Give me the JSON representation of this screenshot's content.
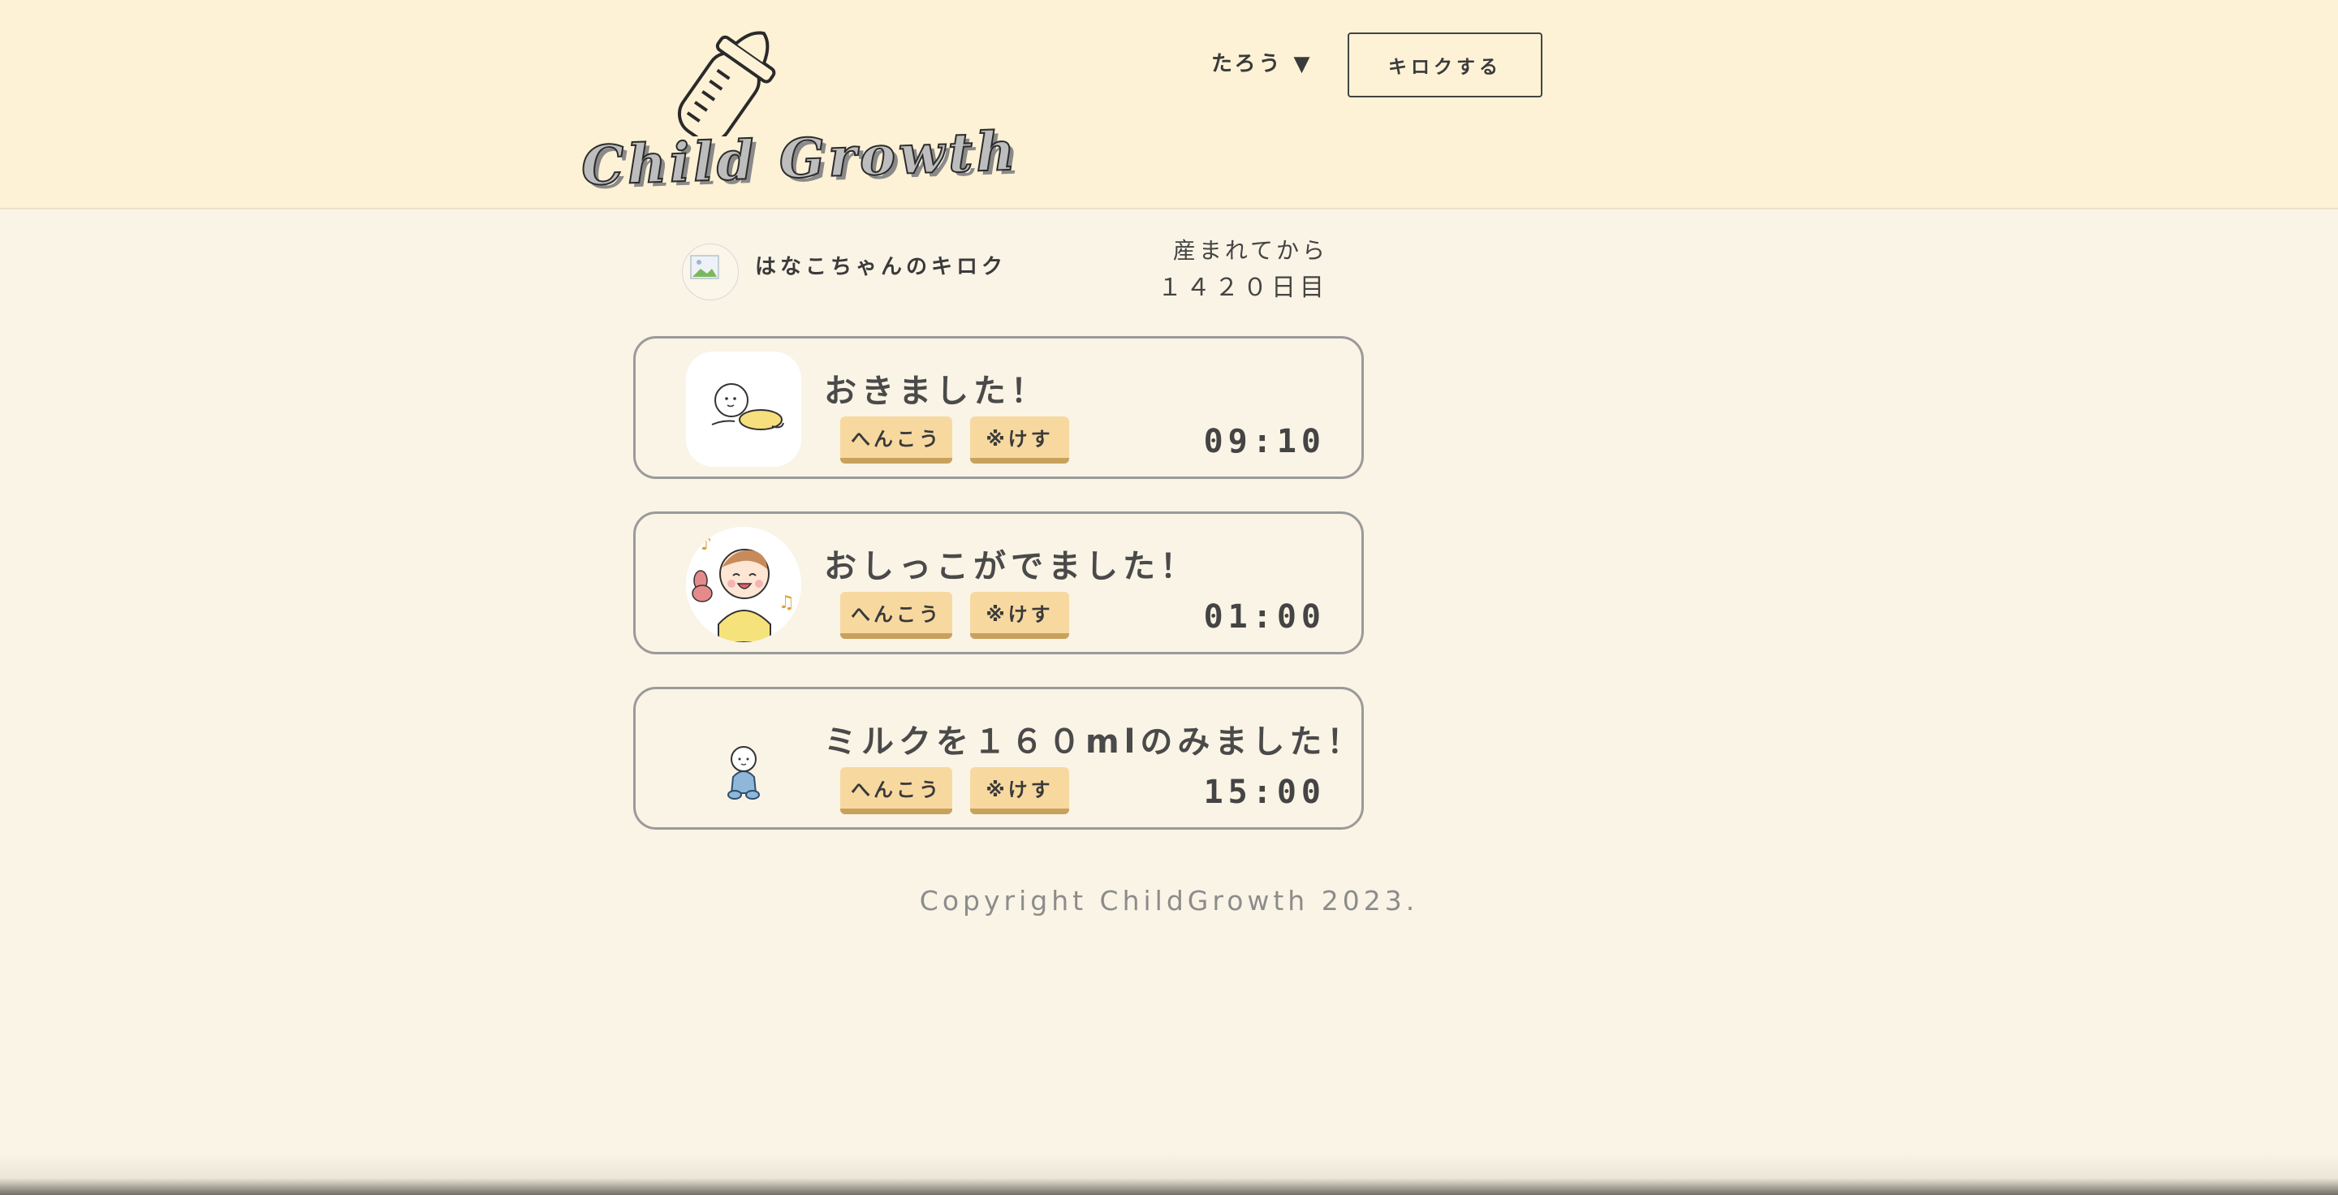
{
  "header": {
    "logo_text": "Child Growth",
    "user_menu": "たろう ▼",
    "record_button": "キロクする"
  },
  "profile": {
    "title": "はなこちゃんのキロク",
    "days_label": "産まれてから",
    "days_value": "１４２０日目"
  },
  "records": [
    {
      "title": "おきました！",
      "edit_label": "へんこう",
      "delete_label": "※けす",
      "time": "09:10"
    },
    {
      "title": "おしっこがでました！",
      "edit_label": "へんこう",
      "delete_label": "※けす",
      "time": "01:00"
    },
    {
      "title": "ミルクを１６０mlのみました！",
      "edit_label": "へんこう",
      "delete_label": "※けす",
      "time": "15:00"
    }
  ],
  "footer": {
    "copyright": "Copyright ChildGrowth 2023."
  },
  "colors": {
    "background": "#faf4e6",
    "header_bg": "#fdf2d6",
    "tag_button": "#f7d9a0",
    "card_border": "#9a9a9a"
  }
}
